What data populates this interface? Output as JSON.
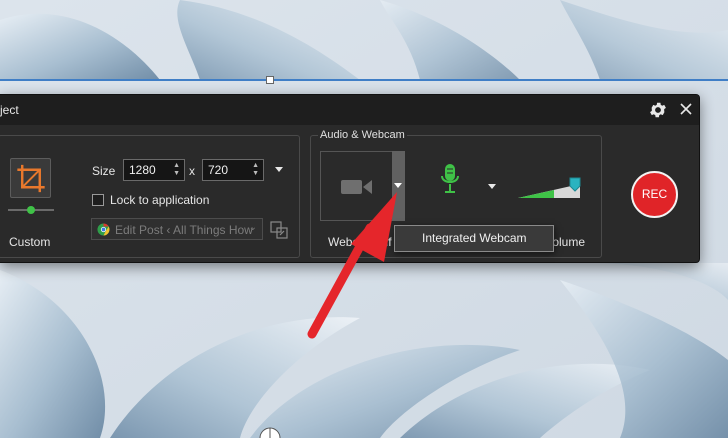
{
  "window": {
    "title": "ject"
  },
  "region": {
    "preset_label": "Custom",
    "size_label": "Size",
    "width": "1280",
    "times": "x",
    "height": "720",
    "lock_label": "Lock to application",
    "lock_checked": false,
    "app_value": "Edit Post ‹ All Things How"
  },
  "audio": {
    "group_title": "Audio & Webcam",
    "webcam_label": "Webcam off",
    "volume_label": "Volume",
    "webcam_menu_item": "Integrated Webcam"
  },
  "rec": {
    "label": "REC"
  },
  "icons": {
    "settings": "gear-icon",
    "close": "close-icon",
    "crop": "crop-icon",
    "webcam": "video-camera-icon",
    "microphone": "microphone-icon",
    "volume": "volume-slider-icon",
    "app": "chrome-icon",
    "snap": "snap-to-window-icon"
  },
  "colors": {
    "accent_orange": "#e8782c",
    "rec_red": "#e02428",
    "mic_green": "#3fc247",
    "pointer_arrow_red": "#e5262b",
    "selection_blue": "#3f7ec6"
  }
}
